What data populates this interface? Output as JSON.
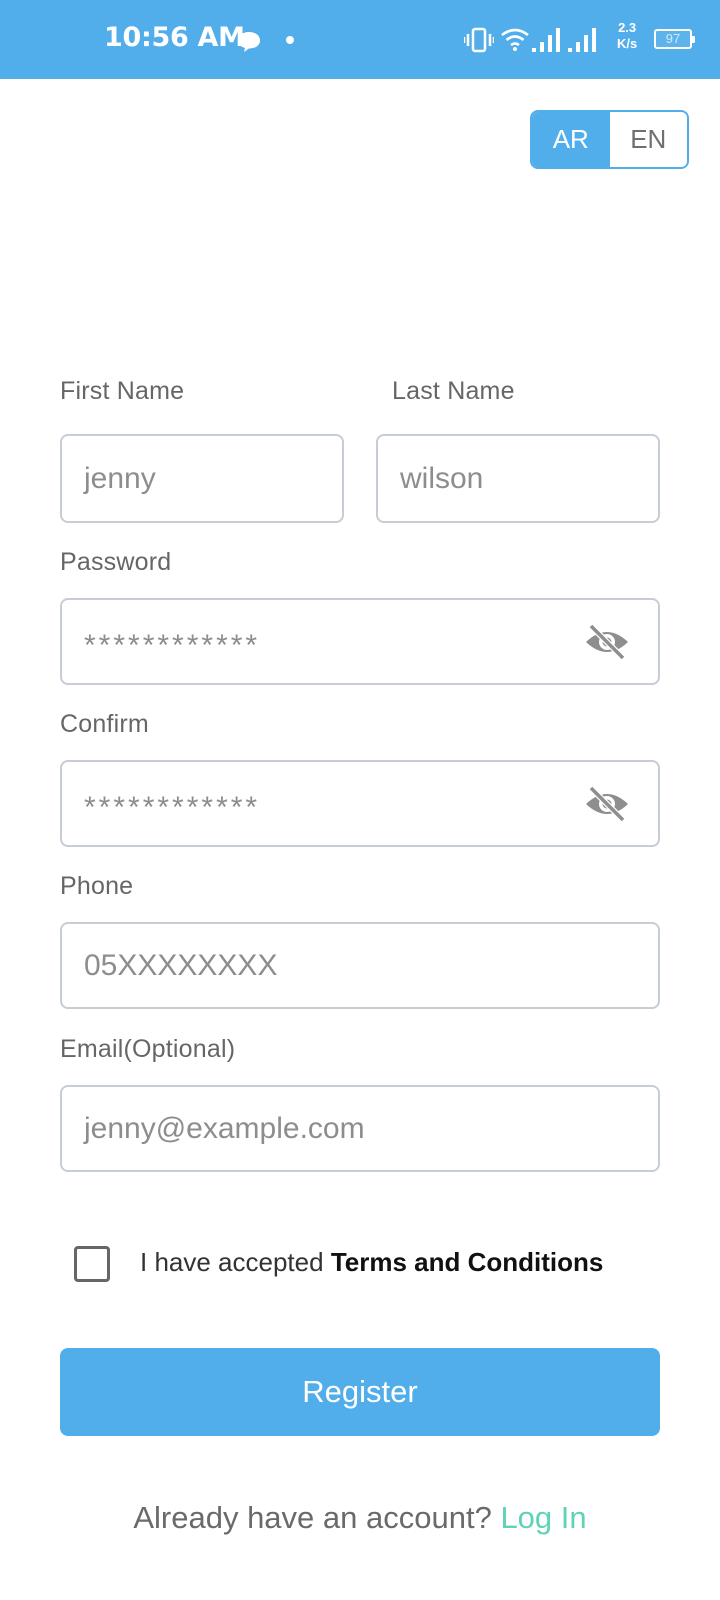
{
  "status_bar": {
    "time": "10:56 AM",
    "network_speed_value": "2.3",
    "network_speed_unit": "K/s",
    "battery": "97",
    "color": "#52aeea"
  },
  "language": {
    "options": [
      "AR",
      "EN"
    ],
    "selected": "AR"
  },
  "form": {
    "first_name": {
      "label": "First Name",
      "value": "jenny"
    },
    "last_name": {
      "label": "Last Name",
      "value": "wilson"
    },
    "password": {
      "label": "Password",
      "value": "************"
    },
    "confirm": {
      "label": "Confirm",
      "value": "************"
    },
    "phone": {
      "label": "Phone",
      "placeholder": "05XXXXXXXX"
    },
    "email": {
      "label": "Email(Optional)",
      "placeholder": "jenny@example.com"
    }
  },
  "terms": {
    "prefix": "I have accepted",
    "link": "Terms and Conditions",
    "checked": false
  },
  "register_button": "Register",
  "login": {
    "prompt": "Already have an account?",
    "link": "Log In",
    "link_color": "#5ed3b8"
  },
  "icons": [
    "chat-bubble-icon",
    "vibrate-icon",
    "wifi-icon",
    "signal-icon",
    "battery-icon",
    "eye-off-icon"
  ]
}
